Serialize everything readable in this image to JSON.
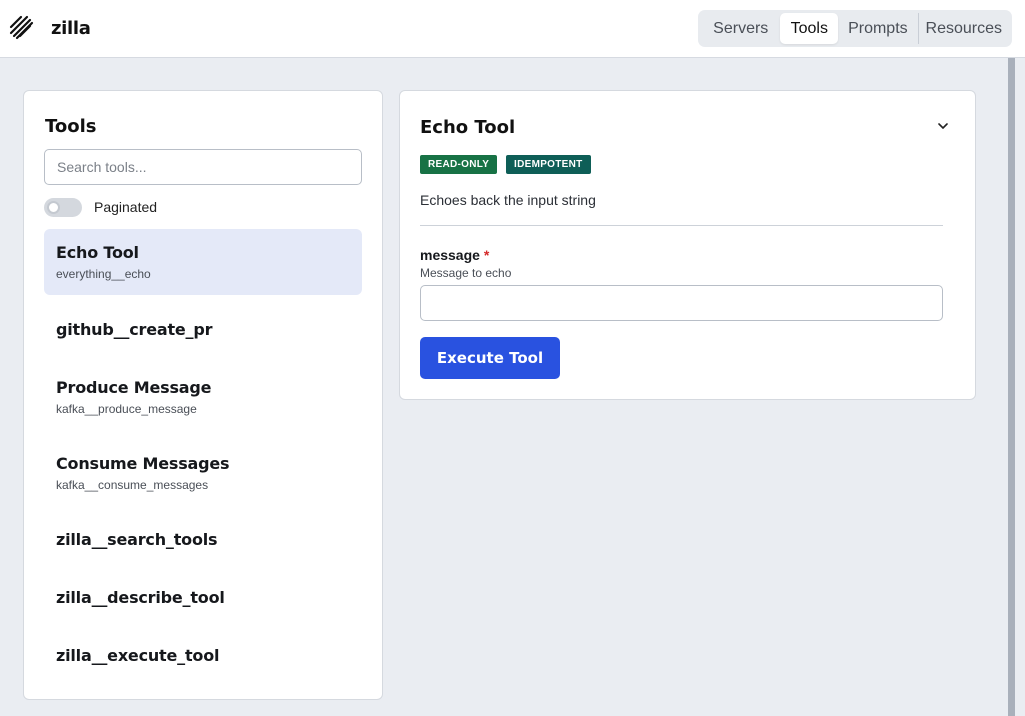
{
  "app": {
    "logo_icon": "zilla-logo-icon",
    "name": "zilla"
  },
  "nav": {
    "items": [
      {
        "label": "Servers",
        "active": false
      },
      {
        "label": "Tools",
        "active": true
      },
      {
        "label": "Prompts",
        "active": false
      },
      {
        "label": "Resources",
        "active": false
      }
    ]
  },
  "tools_panel": {
    "title": "Tools",
    "search_placeholder": "Search tools...",
    "search_value": "",
    "paginated_label": "Paginated",
    "paginated_on": false,
    "items": [
      {
        "name": "Echo Tool",
        "id": "everything__echo",
        "selected": true
      },
      {
        "name": "github__create_pr",
        "id": "",
        "selected": false
      },
      {
        "name": "Produce Message",
        "id": "kafka__produce_message",
        "selected": false
      },
      {
        "name": "Consume Messages",
        "id": "kafka__consume_messages",
        "selected": false
      },
      {
        "name": "zilla__search_tools",
        "id": "",
        "selected": false
      },
      {
        "name": "zilla__describe_tool",
        "id": "",
        "selected": false
      },
      {
        "name": "zilla__execute_tool",
        "id": "",
        "selected": false
      }
    ]
  },
  "detail": {
    "title": "Echo Tool",
    "collapse_icon": "chevron-down-icon",
    "badges": {
      "read_only": "READ-ONLY",
      "idempotent": "IDEMPOTENT"
    },
    "description": "Echoes back the input string",
    "field": {
      "label": "message",
      "required_marker": "*",
      "help": "Message to echo",
      "value": ""
    },
    "execute_label": "Execute Tool"
  },
  "colors": {
    "accent": "#2952e0",
    "selected_bg": "#e4e9f8",
    "badge_readonly": "#177245",
    "badge_idempotent": "#0e5e57",
    "required": "#d42a2a"
  }
}
